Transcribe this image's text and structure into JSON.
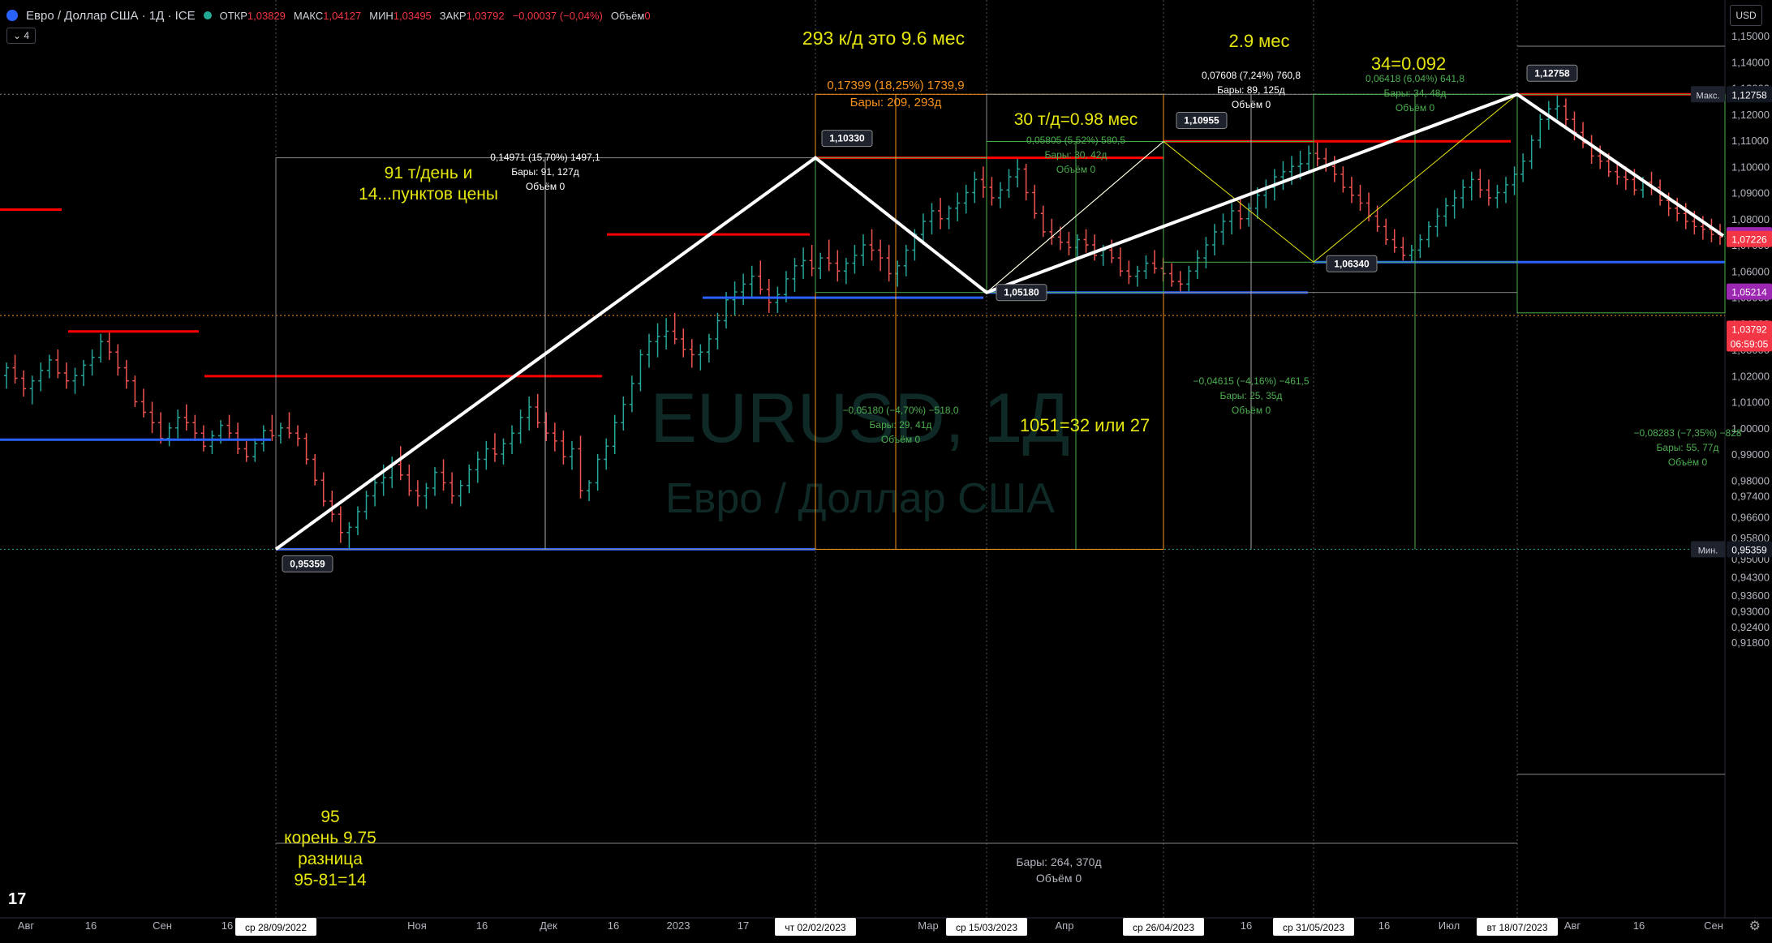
{
  "header": {
    "symbol": "Евро / Доллар США · 1Д · ICE",
    "open_label": "ОТКР",
    "open": "1,03829",
    "high_label": "МАКС",
    "high": "1,04127",
    "low_label": "МИН",
    "low": "1,03495",
    "close_label": "ЗАКР",
    "close": "1,03792",
    "change": "−0,00037 (−0,04%)",
    "volume_label": "Объём",
    "volume": "0",
    "interval_toggle": "⌄ 4",
    "currency": "USD"
  },
  "watermark": {
    "symbol": "EURUSD, 1Д",
    "name": "Евро / Доллар США"
  },
  "colors": {
    "bg": "#000000",
    "up": "#26a69a",
    "down": "#ef5350",
    "red_level": "#ff0000",
    "blue_level": "#2962ff",
    "annot_yellow": "#e5e510",
    "orange": "#f7931a",
    "green_label": "#4caf50"
  },
  "chart_data": {
    "type": "bar",
    "title": "Евро / Доллар США · 1Д · ICE",
    "ylim": [
      0.9178,
      1.1582
    ],
    "y_ticks": [
      "1,15000",
      "1,14000",
      "1,13000",
      "1,12000",
      "1,11000",
      "1,10000",
      "1,09000",
      "1,08000",
      "1,07000",
      "1,06000",
      "1,05000",
      "1,04000",
      "1,03000",
      "1,02000",
      "1,01000",
      "1,00000",
      "0,99000",
      "0,98000",
      "0,97400",
      "0,96600",
      "0,95800",
      "0,95000",
      "0,94300",
      "0,93600",
      "0,93000",
      "0,92400",
      "0,91800"
    ],
    "x_ticks": [
      "Авг",
      "16",
      "Сен",
      "16",
      "Ноя",
      "16",
      "Дек",
      "16",
      "2023",
      "17",
      "Мар",
      "Апр",
      "16",
      "16",
      "Июл",
      "Авг",
      "16",
      "Сен"
    ],
    "x_date_labels": [
      "ср 28/09/2022",
      "чт 02/02/2023",
      "ср 15/03/2023",
      "ср 26/04/2023",
      "ср 31/05/2023",
      "вт 18/07/2023"
    ],
    "price_labels": [
      {
        "text": "1,12758",
        "color": "#0c0c0c",
        "tag": "Макс."
      },
      {
        "text": "1,07369",
        "color": "#9c27b0"
      },
      {
        "text": "1,07226",
        "color": "#f23645"
      },
      {
        "text": "1,05214",
        "color": "#9c27b0"
      },
      {
        "text": "1,03792",
        "color": "#f23645"
      },
      {
        "text": "06:59:05",
        "color": "#f23645"
      },
      {
        "text": "0,95359",
        "color": "#0c0c0c",
        "tag": "Мин."
      }
    ],
    "pivots": [
      {
        "date": "2022-09-28",
        "price": 0.95359,
        "label": "0,95359"
      },
      {
        "date": "2023-02-02",
        "price": 1.1033,
        "label": "1,10330"
      },
      {
        "date": "2023-03-15",
        "price": 1.0518,
        "label": "1,05180"
      },
      {
        "date": "2023-04-26",
        "price": 1.10955,
        "label": "1,10955"
      },
      {
        "date": "2023-05-31",
        "price": 1.0634,
        "label": "1,06340"
      },
      {
        "date": "2023-07-18",
        "price": 1.12758,
        "label": "1,12758"
      }
    ],
    "candles_note": "EURUSD daily candles, Jul 2022 – Sep 2023, approximate OHLC",
    "candles": [
      [
        1.02,
        1.025,
        1.015,
        1.023
      ],
      [
        1.023,
        1.028,
        1.017,
        1.019
      ],
      [
        1.019,
        1.022,
        1.012,
        1.015
      ],
      [
        1.015,
        1.02,
        1.009,
        1.018
      ],
      [
        1.018,
        1.025,
        1.014,
        1.022
      ],
      [
        1.022,
        1.028,
        1.019,
        1.026
      ],
      [
        1.026,
        1.03,
        1.019,
        1.021
      ],
      [
        1.021,
        1.025,
        1.015,
        1.018
      ],
      [
        1.018,
        1.023,
        1.013,
        1.02
      ],
      [
        1.02,
        1.026,
        1.016,
        1.024
      ],
      [
        1.024,
        1.03,
        1.02,
        1.027
      ],
      [
        1.027,
        1.036,
        1.025,
        1.033
      ],
      [
        1.033,
        1.0369,
        1.026,
        1.029
      ],
      [
        1.029,
        1.032,
        1.02,
        1.023
      ],
      [
        1.023,
        1.026,
        1.015,
        1.018
      ],
      [
        1.018,
        1.02,
        1.008,
        1.01
      ],
      [
        1.01,
        1.015,
        1.004,
        1.006
      ],
      [
        1.006,
        1.01,
        0.998,
        1.002
      ],
      [
        1.002,
        1.006,
        0.994,
        0.996
      ],
      [
        0.996,
        1.002,
        0.993,
        1.0
      ],
      [
        1.0,
        1.007,
        0.996,
        1.004
      ],
      [
        1.004,
        1.009,
        0.999,
        1.002
      ],
      [
        1.002,
        1.005,
        0.995,
        0.998
      ],
      [
        0.998,
        1.001,
        0.991,
        0.993
      ],
      [
        0.993,
        0.999,
        0.99,
        0.997
      ],
      [
        0.997,
        1.003,
        0.994,
        1.001
      ],
      [
        1.001,
        1.005,
        0.996,
        0.998
      ],
      [
        0.998,
        1.002,
        0.99,
        0.992
      ],
      [
        0.992,
        0.995,
        0.987,
        0.989
      ],
      [
        0.989,
        0.996,
        0.987,
        0.994
      ],
      [
        0.994,
        1.001,
        0.991,
        0.999
      ],
      [
        0.999,
        1.005,
        0.995,
        0.997
      ],
      [
        0.997,
        1.002,
        0.994,
        1.0
      ],
      [
        1.0,
        1.006,
        0.996,
        0.998
      ],
      [
        0.998,
        1.001,
        0.993,
        0.996
      ],
      [
        0.996,
        0.998,
        0.986,
        0.988
      ],
      [
        0.988,
        0.99,
        0.978,
        0.98
      ],
      [
        0.98,
        0.983,
        0.97,
        0.972
      ],
      [
        0.972,
        0.976,
        0.964,
        0.967
      ],
      [
        0.967,
        0.97,
        0.956,
        0.96
      ],
      [
        0.96,
        0.964,
        0.9536,
        0.962
      ],
      [
        0.962,
        0.97,
        0.959,
        0.968
      ],
      [
        0.968,
        0.976,
        0.965,
        0.974
      ],
      [
        0.974,
        0.982,
        0.97,
        0.979
      ],
      [
        0.979,
        0.986,
        0.974,
        0.981
      ],
      [
        0.981,
        0.989,
        0.977,
        0.986
      ],
      [
        0.986,
        0.993,
        0.98,
        0.982
      ],
      [
        0.982,
        0.986,
        0.974,
        0.976
      ],
      [
        0.976,
        0.98,
        0.97,
        0.974
      ],
      [
        0.974,
        0.979,
        0.969,
        0.977
      ],
      [
        0.977,
        0.985,
        0.974,
        0.983
      ],
      [
        0.983,
        0.988,
        0.976,
        0.979
      ],
      [
        0.979,
        0.983,
        0.971,
        0.974
      ],
      [
        0.974,
        0.98,
        0.97,
        0.978
      ],
      [
        0.978,
        0.986,
        0.975,
        0.984
      ],
      [
        0.984,
        0.991,
        0.979,
        0.988
      ],
      [
        0.988,
        0.995,
        0.984,
        0.992
      ],
      [
        0.992,
        0.998,
        0.987,
        0.99
      ],
      [
        0.99,
        0.996,
        0.986,
        0.994
      ],
      [
        0.994,
        1.001,
        0.99,
        0.998
      ],
      [
        0.998,
        1.007,
        0.994,
        1.004
      ],
      [
        1.004,
        1.012,
        0.999,
        1.008
      ],
      [
        1.008,
        1.013,
        1.0,
        1.002
      ],
      [
        1.002,
        1.006,
        0.995,
        0.998
      ],
      [
        0.998,
        1.002,
        0.991,
        0.995
      ],
      [
        0.995,
        0.999,
        0.986,
        0.989
      ],
      [
        0.989,
        0.995,
        0.984,
        0.992
      ],
      [
        0.992,
        0.997,
        0.973,
        0.976
      ],
      [
        0.976,
        0.98,
        0.972,
        0.979
      ],
      [
        0.979,
        0.99,
        0.976,
        0.988
      ],
      [
        0.988,
        0.996,
        0.984,
        0.993
      ],
      [
        0.993,
        1.005,
        0.99,
        1.002
      ],
      [
        1.002,
        1.012,
        0.999,
        1.009
      ],
      [
        1.009,
        1.02,
        1.006,
        1.017
      ],
      [
        1.017,
        1.03,
        1.014,
        1.028
      ],
      [
        1.028,
        1.036,
        1.023,
        1.033
      ],
      [
        1.033,
        1.04,
        1.027,
        1.035
      ],
      [
        1.035,
        1.042,
        1.03,
        1.037
      ],
      [
        1.037,
        1.044,
        1.032,
        1.034
      ],
      [
        1.034,
        1.038,
        1.027,
        1.03
      ],
      [
        1.03,
        1.034,
        1.023,
        1.028
      ],
      [
        1.028,
        1.032,
        1.022,
        1.029
      ],
      [
        1.029,
        1.036,
        1.025,
        1.034
      ],
      [
        1.034,
        1.044,
        1.03,
        1.041
      ],
      [
        1.041,
        1.052,
        1.038,
        1.049
      ],
      [
        1.049,
        1.056,
        1.043,
        1.052
      ],
      [
        1.052,
        1.059,
        1.047,
        1.055
      ],
      [
        1.055,
        1.062,
        1.05,
        1.058
      ],
      [
        1.058,
        1.064,
        1.051,
        1.053
      ],
      [
        1.053,
        1.057,
        1.044,
        1.048
      ],
      [
        1.048,
        1.054,
        1.044,
        1.051
      ],
      [
        1.051,
        1.06,
        1.048,
        1.057
      ],
      [
        1.057,
        1.065,
        1.052,
        1.062
      ],
      [
        1.062,
        1.069,
        1.057,
        1.064
      ],
      [
        1.064,
        1.07,
        1.058,
        1.061
      ],
      [
        1.061,
        1.067,
        1.057,
        1.065
      ],
      [
        1.065,
        1.072,
        1.06,
        1.063
      ],
      [
        1.063,
        1.068,
        1.056,
        1.06
      ],
      [
        1.06,
        1.065,
        1.055,
        1.063
      ],
      [
        1.063,
        1.07,
        1.059,
        1.066
      ],
      [
        1.066,
        1.074,
        1.062,
        1.07
      ],
      [
        1.07,
        1.076,
        1.064,
        1.068
      ],
      [
        1.068,
        1.072,
        1.06,
        1.065
      ],
      [
        1.065,
        1.07,
        1.056,
        1.059
      ],
      [
        1.059,
        1.064,
        1.054,
        1.062
      ],
      [
        1.062,
        1.07,
        1.058,
        1.068
      ],
      [
        1.068,
        1.076,
        1.064,
        1.074
      ],
      [
        1.074,
        1.082,
        1.07,
        1.079
      ],
      [
        1.079,
        1.086,
        1.074,
        1.083
      ],
      [
        1.083,
        1.088,
        1.076,
        1.08
      ],
      [
        1.08,
        1.085,
        1.076,
        1.084
      ],
      [
        1.084,
        1.09,
        1.079,
        1.086
      ],
      [
        1.086,
        1.093,
        1.082,
        1.09
      ],
      [
        1.09,
        1.098,
        1.086,
        1.095
      ],
      [
        1.095,
        1.1,
        1.088,
        1.092
      ],
      [
        1.092,
        1.096,
        1.085,
        1.088
      ],
      [
        1.088,
        1.094,
        1.084,
        1.091
      ],
      [
        1.091,
        1.099,
        1.088,
        1.096
      ],
      [
        1.096,
        1.1033,
        1.092,
        1.099
      ],
      [
        1.099,
        1.101,
        1.087,
        1.09
      ],
      [
        1.09,
        1.093,
        1.08,
        1.082
      ],
      [
        1.082,
        1.085,
        1.073,
        1.075
      ],
      [
        1.075,
        1.08,
        1.07,
        1.073
      ],
      [
        1.073,
        1.077,
        1.068,
        1.071
      ],
      [
        1.071,
        1.075,
        1.066,
        1.069
      ],
      [
        1.069,
        1.074,
        1.065,
        1.072
      ],
      [
        1.072,
        1.076,
        1.067,
        1.07
      ],
      [
        1.07,
        1.074,
        1.064,
        1.066
      ],
      [
        1.066,
        1.07,
        1.062,
        1.068
      ],
      [
        1.068,
        1.072,
        1.063,
        1.065
      ],
      [
        1.065,
        1.069,
        1.058,
        1.06
      ],
      [
        1.06,
        1.064,
        1.055,
        1.058
      ],
      [
        1.058,
        1.062,
        1.054,
        1.06
      ],
      [
        1.06,
        1.066,
        1.057,
        1.063
      ],
      [
        1.063,
        1.068,
        1.059,
        1.061
      ],
      [
        1.061,
        1.065,
        1.056,
        1.059
      ],
      [
        1.059,
        1.063,
        1.054,
        1.056
      ],
      [
        1.056,
        1.06,
        1.0518,
        1.055
      ],
      [
        1.055,
        1.062,
        1.052,
        1.06
      ],
      [
        1.06,
        1.068,
        1.057,
        1.065
      ],
      [
        1.065,
        1.073,
        1.061,
        1.07
      ],
      [
        1.07,
        1.078,
        1.066,
        1.075
      ],
      [
        1.075,
        1.082,
        1.07,
        1.079
      ],
      [
        1.079,
        1.086,
        1.074,
        1.083
      ],
      [
        1.083,
        1.088,
        1.076,
        1.08
      ],
      [
        1.08,
        1.086,
        1.077,
        1.084
      ],
      [
        1.084,
        1.092,
        1.08,
        1.089
      ],
      [
        1.089,
        1.095,
        1.084,
        1.092
      ],
      [
        1.092,
        1.099,
        1.087,
        1.096
      ],
      [
        1.096,
        1.102,
        1.091,
        1.098
      ],
      [
        1.098,
        1.104,
        1.093,
        1.1
      ],
      [
        1.1,
        1.106,
        1.095,
        1.101
      ],
      [
        1.101,
        1.108,
        1.098,
        1.105
      ],
      [
        1.105,
        1.1096,
        1.1,
        1.103
      ],
      [
        1.103,
        1.107,
        1.098,
        1.1
      ],
      [
        1.1,
        1.104,
        1.094,
        1.097
      ],
      [
        1.097,
        1.1,
        1.09,
        1.092
      ],
      [
        1.092,
        1.096,
        1.086,
        1.089
      ],
      [
        1.089,
        1.093,
        1.083,
        1.086
      ],
      [
        1.086,
        1.09,
        1.079,
        1.081
      ],
      [
        1.081,
        1.085,
        1.075,
        1.077
      ],
      [
        1.077,
        1.08,
        1.07,
        1.072
      ],
      [
        1.072,
        1.076,
        1.067,
        1.069
      ],
      [
        1.069,
        1.073,
        1.064,
        1.066
      ],
      [
        1.066,
        1.07,
        1.0634,
        1.068
      ],
      [
        1.068,
        1.074,
        1.065,
        1.072
      ],
      [
        1.072,
        1.079,
        1.069,
        1.077
      ],
      [
        1.077,
        1.084,
        1.073,
        1.081
      ],
      [
        1.081,
        1.088,
        1.077,
        1.085
      ],
      [
        1.085,
        1.091,
        1.08,
        1.088
      ],
      [
        1.088,
        1.095,
        1.084,
        1.092
      ],
      [
        1.092,
        1.098,
        1.087,
        1.095
      ],
      [
        1.095,
        1.099,
        1.088,
        1.091
      ],
      [
        1.091,
        1.095,
        1.085,
        1.088
      ],
      [
        1.088,
        1.093,
        1.084,
        1.09
      ],
      [
        1.09,
        1.096,
        1.086,
        1.093
      ],
      [
        1.093,
        1.1,
        1.089,
        1.097
      ],
      [
        1.097,
        1.105,
        1.094,
        1.102
      ],
      [
        1.102,
        1.112,
        1.099,
        1.11
      ],
      [
        1.11,
        1.12,
        1.107,
        1.118
      ],
      [
        1.118,
        1.125,
        1.114,
        1.122
      ],
      [
        1.122,
        1.1276,
        1.118,
        1.123
      ],
      [
        1.123,
        1.126,
        1.115,
        1.118
      ],
      [
        1.118,
        1.121,
        1.11,
        1.113
      ],
      [
        1.113,
        1.117,
        1.107,
        1.109
      ],
      [
        1.109,
        1.112,
        1.101,
        1.104
      ],
      [
        1.104,
        1.108,
        1.099,
        1.102
      ],
      [
        1.102,
        1.105,
        1.096,
        1.098
      ],
      [
        1.098,
        1.102,
        1.093,
        1.096
      ],
      [
        1.096,
        1.1,
        1.091,
        1.095
      ],
      [
        1.095,
        1.099,
        1.089,
        1.091
      ],
      [
        1.091,
        1.096,
        1.088,
        1.094
      ],
      [
        1.094,
        1.098,
        1.089,
        1.092
      ],
      [
        1.092,
        1.095,
        1.085,
        1.087
      ],
      [
        1.087,
        1.09,
        1.081,
        1.084
      ],
      [
        1.084,
        1.088,
        1.079,
        1.082
      ],
      [
        1.082,
        1.086,
        1.076,
        1.079
      ],
      [
        1.079,
        1.083,
        1.074,
        1.077
      ],
      [
        1.077,
        1.081,
        1.072,
        1.076
      ],
      [
        1.076,
        1.08,
        1.071,
        1.074
      ],
      [
        1.074,
        1.078,
        1.07,
        1.073
      ]
    ],
    "measurements": [
      {
        "lines": [
          "0,14971 (15,70%) 1497,1",
          "Бары: 91, 127д",
          "Объём 0"
        ],
        "color": "#ffffff"
      },
      {
        "lines": [
          "0,17399 (18,25%) 1739,9",
          "Бары: 209, 293д"
        ],
        "color": "#f7931a"
      },
      {
        "lines": [
          "0,07608 (7,24%) 760,8",
          "Бары: 89, 125д",
          "Объём 0"
        ],
        "color": "#ffffff"
      },
      {
        "lines": [
          "0,05805 (5,52%) 580,5",
          "Бары: 30, 42д",
          "Объём 0"
        ],
        "color": "#4caf50"
      },
      {
        "lines": [
          "0,06418 (6,04%) 641,8",
          "Бары: 34, 48д",
          "Объём 0"
        ],
        "color": "#4caf50"
      },
      {
        "lines": [
          "−0,05180 (−4,70%) −518,0",
          "Бары: 29, 41д",
          "Объём 0"
        ],
        "color": "#4caf50"
      },
      {
        "lines": [
          "−0,04615 (−4,16%) −461,5",
          "Бары: 25, 35д",
          "Объём 0"
        ],
        "color": "#4caf50"
      },
      {
        "lines": [
          "−0,08283 (−7,35%) −828",
          "Бары: 55, 77д",
          "Объём 0"
        ],
        "color": "#4caf50"
      },
      {
        "lines": [
          "Бары: 264, 370д",
          "Объём 0"
        ],
        "color": "#b2b5be"
      }
    ],
    "annotations": [
      "293 к/д это 9.6 мес",
      "2.9 мес",
      "34=0.092",
      "30 т/д=0.98 мес",
      "91 т/день и",
      "14...пунктов цены",
      "1051=32 или 27",
      "95",
      "корень 9.75",
      "разница",
      "95-81=14"
    ]
  }
}
